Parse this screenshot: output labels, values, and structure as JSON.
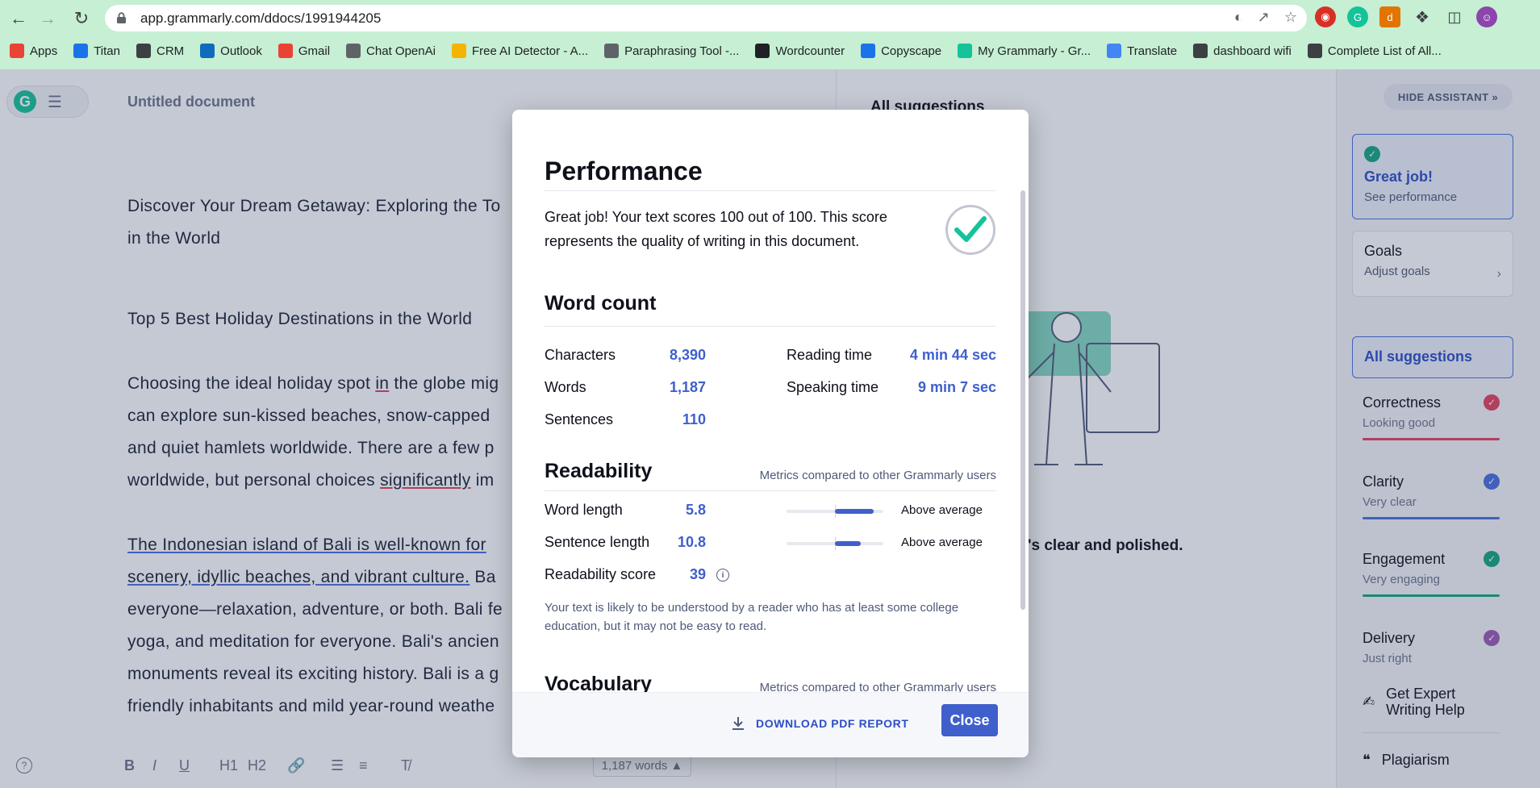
{
  "browser": {
    "url": "app.grammarly.com/ddocs/1991944205",
    "bookmarks": [
      {
        "label": "Apps",
        "icon": "apps-grid-icon",
        "color": "#ea4335"
      },
      {
        "label": "Titan",
        "icon": "mail-icon",
        "color": "#1a73e8"
      },
      {
        "label": "CRM",
        "icon": "crm-icon",
        "color": "#3c4043"
      },
      {
        "label": "Outlook",
        "icon": "outlook-icon",
        "color": "#0f6cbd"
      },
      {
        "label": "Gmail",
        "icon": "gmail-icon",
        "color": "#ea4335"
      },
      {
        "label": "Chat OpenAi",
        "icon": "openai-icon",
        "color": "#5f6368"
      },
      {
        "label": "Free AI Detector - A...",
        "icon": "detector-icon",
        "color": "#f4b400"
      },
      {
        "label": "Paraphrasing Tool -...",
        "icon": "pen-icon",
        "color": "#5f6368"
      },
      {
        "label": "Wordcounter",
        "icon": "wordcounter-icon",
        "color": "#202124"
      },
      {
        "label": "Copyscape",
        "icon": "copyscape-icon",
        "color": "#1a73e8"
      },
      {
        "label": "My Grammarly - Gr...",
        "icon": "grammarly-icon",
        "color": "#15c39a"
      },
      {
        "label": "Translate",
        "icon": "translate-icon",
        "color": "#4285f4"
      },
      {
        "label": "dashboard wifi",
        "icon": "globe-icon",
        "color": "#3c4043"
      },
      {
        "label": "Complete List of All...",
        "icon": "globe-icon",
        "color": "#3c4043"
      }
    ]
  },
  "doc": {
    "title": "Untitled document",
    "heading_line1": "Discover Your Dream Getaway: Exploring the To",
    "heading_line2": "in the World",
    "subheading": "Top 5 Best Holiday Destinations in the World",
    "para1": [
      "Choosing the ideal holiday spot ",
      "in",
      " the globe mig",
      "can explore sun-kissed beaches, snow-capped",
      "and quiet hamlets worldwide. There are a few p",
      "worldwide, but personal choices ",
      "significantly",
      " im"
    ],
    "para2": [
      "The Indonesian island of Bali is well-known for",
      "scenery, idyllic beaches, and vibrant culture.",
      " Ba",
      "everyone—relaxation, adventure, or both. Bali fe",
      "yoga, and meditation for everyone. Bali's ancien",
      "monuments reveal its exciting history. Bali is a g",
      "friendly inhabitants and mild year-round weathe"
    ],
    "word_count": "1,187 words"
  },
  "toolbar": {
    "bold": "B",
    "italic": "I",
    "underline": "U",
    "h1": "H1",
    "h2": "H2"
  },
  "suggestions": {
    "title": "All suggestions",
    "clear_text": "'s clear and polished."
  },
  "assistant": {
    "hide_label": "HIDE ASSISTANT",
    "great": {
      "title": "Great job!",
      "sub": "See performance"
    },
    "goals": {
      "title": "Goals",
      "sub": "Adjust goals"
    },
    "all": "All suggestions",
    "categories": [
      {
        "title": "Correctness",
        "sub": "Looking good",
        "color": "#e3405e"
      },
      {
        "title": "Clarity",
        "sub": "Very clear",
        "color": "#4a6ee0"
      },
      {
        "title": "Engagement",
        "sub": "Very engaging",
        "color": "#15a680"
      },
      {
        "title": "Delivery",
        "sub": "Just right",
        "color": "#9b59b6"
      }
    ],
    "expert": "Get Expert Writing Help",
    "plagiarism": "Plagiarism"
  },
  "modal": {
    "title": "Performance",
    "perf_text": "Great job! Your text scores 100 out of 100. This score represents the quality of writing in this document.",
    "word_count_title": "Word count",
    "stats": {
      "characters_label": "Characters",
      "characters": "8,390",
      "words_label": "Words",
      "words": "1,187",
      "sentences_label": "Sentences",
      "sentences": "110",
      "reading_label": "Reading time",
      "reading": "4 min 44 sec",
      "speaking_label": "Speaking time",
      "speaking": "9 min 7 sec"
    },
    "readability_title": "Readability",
    "metrics_note": "Metrics compared to other Grammarly users",
    "readability": {
      "word_length_label": "Word length",
      "word_length": "5.8",
      "word_length_rating": "Above average",
      "word_length_fill": 0.9,
      "sentence_length_label": "Sentence length",
      "sentence_length": "10.8",
      "sentence_length_rating": "Above average",
      "sentence_length_fill": 0.77,
      "score_label": "Readability score",
      "score": "39"
    },
    "read_note": "Your text is likely to be understood by a reader who has at least some college education, but it may not be easy to read.",
    "vocab_title": "Vocabulary",
    "download": "DOWNLOAD PDF REPORT",
    "close": "Close"
  }
}
